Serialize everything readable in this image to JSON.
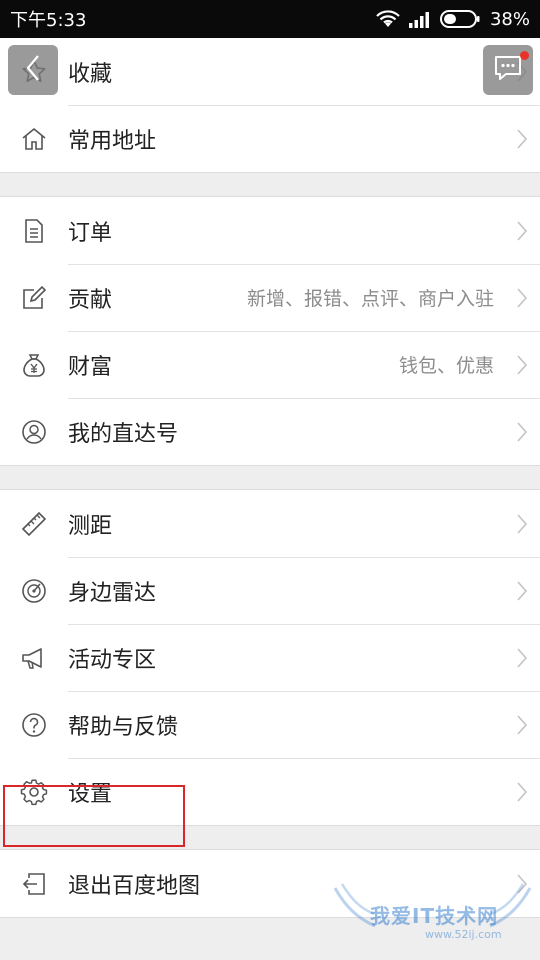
{
  "status_bar": {
    "time": "下午5:33",
    "battery": "38%"
  },
  "group1": [
    {
      "label": "收藏",
      "icon": "star-icon"
    },
    {
      "label": "常用地址",
      "icon": "home-icon"
    }
  ],
  "group2": [
    {
      "label": "订单",
      "icon": "document-icon"
    },
    {
      "label": "贡献",
      "hint": "新增、报错、点评、商户入驻",
      "icon": "edit-icon"
    },
    {
      "label": "财富",
      "hint": "钱包、优惠",
      "icon": "money-bag-icon"
    },
    {
      "label": "我的直达号",
      "icon": "user-circle-icon"
    }
  ],
  "group3": [
    {
      "label": "测距",
      "icon": "ruler-icon"
    },
    {
      "label": "身边雷达",
      "icon": "radar-icon"
    },
    {
      "label": "活动专区",
      "icon": "megaphone-icon"
    },
    {
      "label": "帮助与反馈",
      "icon": "help-icon"
    },
    {
      "label": "设置",
      "icon": "gear-icon"
    }
  ],
  "group4": [
    {
      "label": "退出百度地图",
      "icon": "exit-icon"
    }
  ],
  "watermark": {
    "text": "我爱IT技术网",
    "url": "www.52ij.com"
  },
  "colors": {
    "highlight": "#d9262b",
    "notification_dot": "#e8332a"
  }
}
